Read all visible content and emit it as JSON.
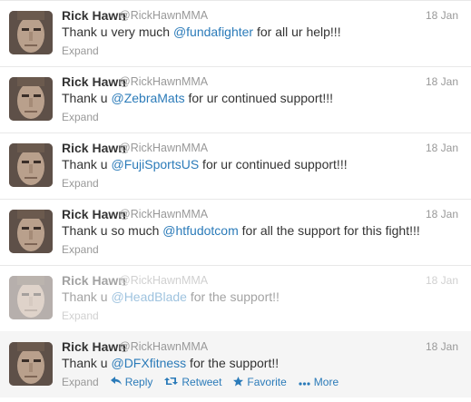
{
  "colors": {
    "mention": "#2b7bb9",
    "meta": "#999999",
    "text": "#333333",
    "hover_bg": "#f5f5f5"
  },
  "tweets": [
    {
      "name": "Rick Hawn",
      "handle": "@RickHawnMMA",
      "date": "18 Jan",
      "text_before": "Thank u very much ",
      "mention": "@fundafighter",
      "text_after": " for all ur help!!!",
      "expand": "Expand"
    },
    {
      "name": "Rick Hawn",
      "handle": "@RickHawnMMA",
      "date": "18 Jan",
      "text_before": "Thank u ",
      "mention": "@ZebraMats",
      "text_after": " for ur continued support!!!",
      "expand": "Expand"
    },
    {
      "name": "Rick Hawn",
      "handle": "@RickHawnMMA",
      "date": "18 Jan",
      "text_before": "Thank u ",
      "mention": "@FujiSportsUS",
      "text_after": " for ur continued support!!!",
      "expand": "Expand"
    },
    {
      "name": "Rick Hawn",
      "handle": "@RickHawnMMA",
      "date": "18 Jan",
      "text_before": "Thank u so much ",
      "mention": "@htfudotcom",
      "text_after": " for all the support for this fight!!!",
      "expand": "Expand"
    },
    {
      "name": "Rick Hawn",
      "handle": "@RickHawnMMA",
      "date": "18 Jan",
      "text_before": "Thank u ",
      "mention": "@HeadBlade",
      "text_after": " for the support!!",
      "expand": "Expand"
    },
    {
      "name": "Rick Hawn",
      "handle": "@RickHawnMMA",
      "date": "18 Jan",
      "text_before": "Thank u ",
      "mention": "@DFXfitness",
      "text_after": " for the support!!",
      "expand": "Expand",
      "actions": {
        "reply": "Reply",
        "retweet": "Retweet",
        "favorite": "Favorite",
        "more": "More"
      }
    }
  ]
}
